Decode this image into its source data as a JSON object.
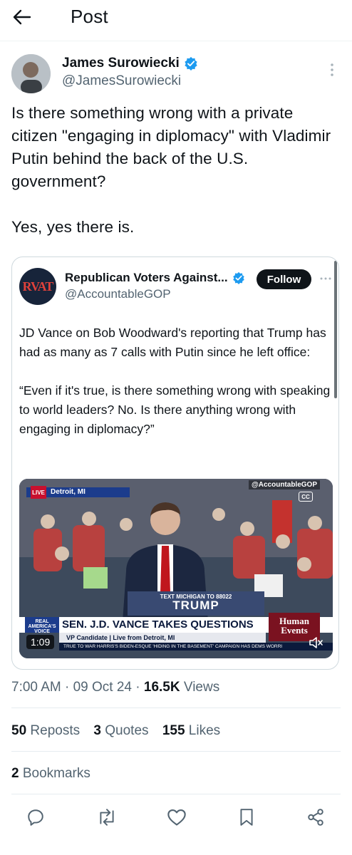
{
  "header": {
    "title": "Post"
  },
  "author": {
    "name": "James Surowiecki",
    "handle": "@JamesSurowiecki"
  },
  "post": {
    "text": "Is there something wrong with a private citizen \"engaging in diplomacy\" with Vladimir Putin behind the back of the U.S. government?\n\nYes, yes there is."
  },
  "quote": {
    "avatar_text": "RVAT",
    "name": "Republican Voters Against...",
    "handle": "@AccountableGOP",
    "follow_label": "Follow",
    "text": "JD Vance on Bob Woodward's reporting that Trump has had as many as 7 calls with Putin since he left office:\n\n“Even if it's true, is there something wrong with speaking to world leaders? No. Is there anything wrong with engaging in diplomacy?”",
    "video": {
      "watermark": "@AccountableGOP",
      "live": "LIVE",
      "location": "Detroit, MI",
      "cc": "CC",
      "podium_small": "TEXT MICHIGAN TO 88022",
      "podium_big": "TRUMP",
      "chyron_logo": "REAL AMERICA'S VOICE",
      "chyron_title": "SEN. J.D. VANCE TAKES QUESTIONS",
      "chyron_sub": "VP Candidate | Live from Detroit, MI",
      "ticker": "TRUE TO WAR    HARRIS'S BIDEN-ESQUE 'HIDING IN THE BASEMENT' CAMPAIGN HAS DEMS WORRI",
      "human_events_1": "Human",
      "human_events_2": "Events",
      "duration": "1:09"
    }
  },
  "meta": {
    "time": "7:00 AM",
    "date": "09 Oct 24",
    "views_count": "16.5K",
    "views_label": "Views"
  },
  "stats": {
    "reposts_count": "50",
    "reposts_label": "Reposts",
    "quotes_count": "3",
    "quotes_label": "Quotes",
    "likes_count": "155",
    "likes_label": "Likes",
    "bookmarks_count": "2",
    "bookmarks_label": "Bookmarks"
  },
  "colors": {
    "text": "#0f1419",
    "secondary": "#536471",
    "verified": "#1d9bf0"
  },
  "icons": [
    "back-arrow-icon",
    "verified-badge-icon",
    "more-icon",
    "reply-icon",
    "repost-icon",
    "like-icon",
    "bookmark-icon",
    "share-icon"
  ]
}
